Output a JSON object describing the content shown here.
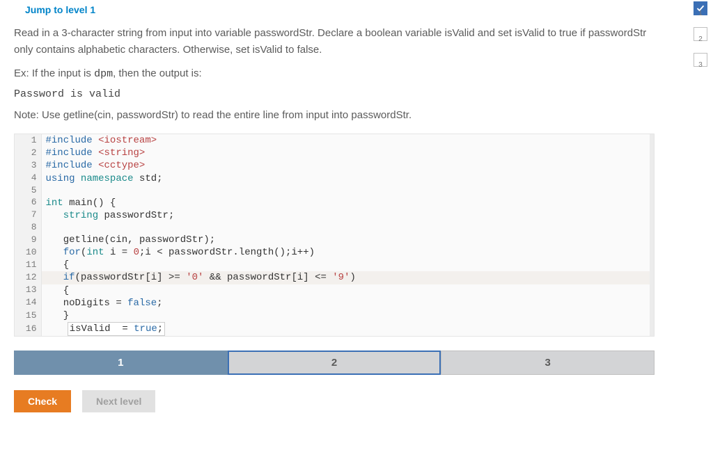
{
  "header": {
    "jump_link": "Jump to level 1"
  },
  "instruction": {
    "text": "Read in a 3-character string from input into variable passwordStr. Declare a boolean variable isValid and set isValid to true if passwordStr only contains alphabetic characters. Otherwise, set isValid to false.",
    "example_prefix": "Ex: If the input is ",
    "example_input": "dpm",
    "example_suffix": ", then the output is:",
    "example_output": "Password is valid",
    "note": "Note: Use getline(cin, passwordStr) to read the entire line from input into passwordStr."
  },
  "code": {
    "lines": [
      {
        "n": 1,
        "tokens": [
          {
            "t": "#include ",
            "c": "kw-blue"
          },
          {
            "t": "<iostream>",
            "c": "str-red"
          }
        ]
      },
      {
        "n": 2,
        "tokens": [
          {
            "t": "#include ",
            "c": "kw-blue"
          },
          {
            "t": "<string>",
            "c": "str-red"
          }
        ]
      },
      {
        "n": 3,
        "tokens": [
          {
            "t": "#include ",
            "c": "kw-blue"
          },
          {
            "t": "<cctype>",
            "c": "str-red"
          }
        ]
      },
      {
        "n": 4,
        "tokens": [
          {
            "t": "using ",
            "c": "kw-blue"
          },
          {
            "t": "namespace ",
            "c": "kw-teal"
          },
          {
            "t": "std",
            "c": "ident"
          },
          {
            "t": ";",
            "c": "ident"
          }
        ]
      },
      {
        "n": 5,
        "tokens": [
          {
            "t": "",
            "c": "ident"
          }
        ]
      },
      {
        "n": 6,
        "tokens": [
          {
            "t": "int ",
            "c": "type-teal"
          },
          {
            "t": "main",
            "c": "ident"
          },
          {
            "t": "() {",
            "c": "ident"
          }
        ]
      },
      {
        "n": 7,
        "tokens": [
          {
            "t": "   string ",
            "c": "type-teal"
          },
          {
            "t": "passwordStr",
            "c": "ident"
          },
          {
            "t": ";",
            "c": "ident"
          }
        ]
      },
      {
        "n": 8,
        "tokens": [
          {
            "t": "",
            "c": "ident"
          }
        ]
      },
      {
        "n": 9,
        "tokens": [
          {
            "t": "   getline",
            "c": "ident"
          },
          {
            "t": "(",
            "c": "ident"
          },
          {
            "t": "cin",
            "c": "ident"
          },
          {
            "t": ", ",
            "c": "ident"
          },
          {
            "t": "passwordStr",
            "c": "ident"
          },
          {
            "t": ");",
            "c": "ident"
          }
        ]
      },
      {
        "n": 10,
        "tokens": [
          {
            "t": "   for",
            "c": "kw-blue"
          },
          {
            "t": "(",
            "c": "ident"
          },
          {
            "t": "int ",
            "c": "type-teal"
          },
          {
            "t": "i ",
            "c": "ident"
          },
          {
            "t": "= ",
            "c": "ident"
          },
          {
            "t": "0",
            "c": "num-red"
          },
          {
            "t": ";i ",
            "c": "ident"
          },
          {
            "t": "< ",
            "c": "ident"
          },
          {
            "t": "passwordStr",
            "c": "ident"
          },
          {
            "t": ".",
            "c": "ident"
          },
          {
            "t": "length",
            "c": "ident"
          },
          {
            "t": "();i",
            "c": "ident"
          },
          {
            "t": "++",
            "c": "ident"
          },
          {
            "t": ")",
            "c": "ident"
          }
        ]
      },
      {
        "n": 11,
        "tokens": [
          {
            "t": "   {",
            "c": "ident"
          }
        ]
      },
      {
        "n": 12,
        "hl": true,
        "tokens": [
          {
            "t": "   if",
            "c": "kw-blue"
          },
          {
            "t": "(",
            "c": "ident"
          },
          {
            "t": "passwordStr",
            "c": "ident"
          },
          {
            "t": "[",
            "c": "ident"
          },
          {
            "t": "i",
            "c": "ident"
          },
          {
            "t": "] ",
            "c": "ident"
          },
          {
            "t": ">= ",
            "c": "ident"
          },
          {
            "t": "'0'",
            "c": "str-red"
          },
          {
            "t": " && ",
            "c": "ident"
          },
          {
            "t": "passwordStr",
            "c": "ident"
          },
          {
            "t": "[",
            "c": "ident"
          },
          {
            "t": "i",
            "c": "ident"
          },
          {
            "t": "] ",
            "c": "ident"
          },
          {
            "t": "<= ",
            "c": "ident"
          },
          {
            "t": "'9'",
            "c": "str-red"
          },
          {
            "t": ")",
            "c": "ident"
          }
        ]
      },
      {
        "n": 13,
        "tokens": [
          {
            "t": "   {",
            "c": "ident"
          }
        ]
      },
      {
        "n": 14,
        "tokens": [
          {
            "t": "   noDigits ",
            "c": "ident"
          },
          {
            "t": "= ",
            "c": "ident"
          },
          {
            "t": "false",
            "c": "kw-blue"
          },
          {
            "t": ";",
            "c": "ident"
          }
        ]
      },
      {
        "n": 15,
        "tokens": [
          {
            "t": "   }",
            "c": "ident"
          }
        ]
      },
      {
        "n": 16,
        "tokens": [
          {
            "t": "   ",
            "c": "ident"
          }
        ],
        "boxed": [
          {
            "t": "isValid  ",
            "c": "ident"
          },
          {
            "t": "= ",
            "c": "ident"
          },
          {
            "t": "true",
            "c": "kw-blue"
          },
          {
            "t": ";",
            "c": "ident"
          }
        ]
      }
    ]
  },
  "tabs": {
    "items": [
      {
        "label": "1",
        "active": true
      },
      {
        "label": "2",
        "active": false,
        "current": true
      },
      {
        "label": "3",
        "active": false
      }
    ]
  },
  "buttons": {
    "check": "Check",
    "next": "Next level"
  },
  "progress": {
    "items": [
      {
        "label": "1",
        "done": true
      },
      {
        "label": "2",
        "done": false
      },
      {
        "label": "3",
        "done": false
      }
    ]
  }
}
